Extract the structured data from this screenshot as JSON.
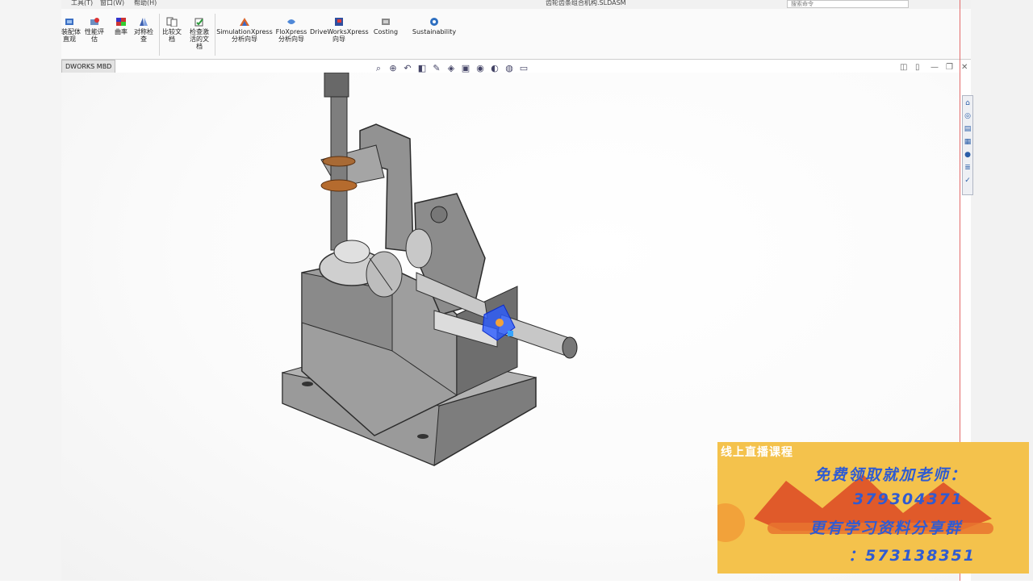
{
  "top": {
    "menu": [
      "工具(T)",
      "窗口(W)",
      "帮助(H)"
    ],
    "doc_title": "齿轮齿条组合机构.SLDASM",
    "search_placeholder": "搜索命令"
  },
  "ribbon": {
    "tools": [
      {
        "label": "装配体\n直观",
        "icon": "assembly-visualization-icon"
      },
      {
        "label": "性能评\n估",
        "icon": "performance-evaluation-icon"
      },
      {
        "label": "曲率",
        "icon": "curvature-icon"
      },
      {
        "label": "对称检\n查",
        "icon": "symmetry-check-icon"
      },
      {
        "label": "比较文\n档",
        "icon": "compare-documents-icon"
      },
      {
        "label": "检查激\n活的文\n档",
        "icon": "check-active-document-icon"
      },
      {
        "label": "SimulationXpress\n分析向导",
        "icon": "simulationxpress-icon"
      },
      {
        "label": "FloXpress\n分析向导",
        "icon": "floxpress-icon"
      },
      {
        "label": "DriveWorksXpress\n向导",
        "icon": "driveworksxpress-icon"
      },
      {
        "label": "Costing",
        "icon": "costing-icon"
      },
      {
        "label": "Sustainability",
        "icon": "sustainability-icon"
      }
    ]
  },
  "tabs": {
    "mbd": "DWORKS MBD"
  },
  "viewport": {
    "background": "#ffffff",
    "hud_icons": [
      "zoom-to-fit-icon",
      "zoom-area-icon",
      "previous-view-icon",
      "section-view-icon",
      "dynamic-annotation-icon",
      "view-orientation-icon",
      "display-style-icon",
      "hide-show-icon",
      "edit-appearance-icon",
      "apply-scene-icon",
      "view-settings-icon"
    ]
  },
  "ad": {
    "header": "线上直播课程",
    "line1": "免费领取就加老师：",
    "line2": "379304371",
    "line3": "更有学习资料分享群",
    "line4": "：573138351",
    "bg": "#f4c24c",
    "text_color": "#2f5bd2"
  },
  "colors": {
    "part_gray": "#8a8a8a",
    "bronze": "#b56b2e",
    "selection_blue": "#2a5bff"
  }
}
